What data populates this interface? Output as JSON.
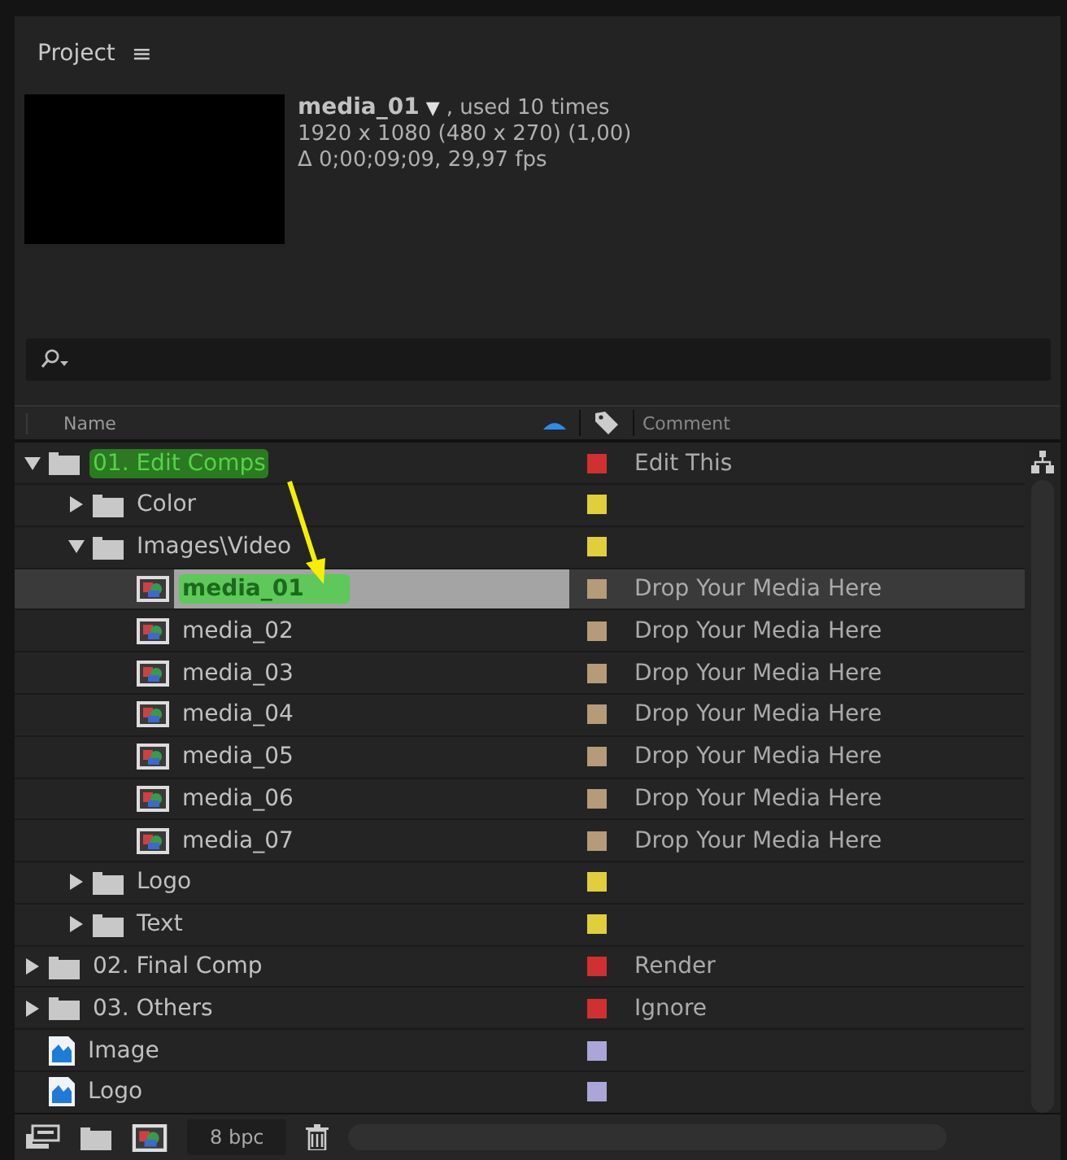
{
  "panel": {
    "title": "Project",
    "menu_glyph": "≡"
  },
  "preview": {
    "name": "media_01",
    "dropdown_glyph": "▼",
    "usage": ", used 10 times",
    "dimensions": "1920 x 1080  (480 x 270) (1,00)",
    "duration": "Δ 0;00;09;09, 29,97 fps"
  },
  "columns": [
    {
      "label": "Name",
      "sorted": true
    },
    {
      "label": "Comment",
      "sorted": false
    }
  ],
  "tree": [
    {
      "kind": "folder",
      "name": "01. Edit Comps",
      "expanded": true,
      "selected": false,
      "highlighted": true,
      "color": "#d03030",
      "comment": "Edit This",
      "children": [
        {
          "kind": "folder",
          "name": "Color",
          "expanded": false,
          "selected": false,
          "highlighted": false,
          "color": "#e0cf3a"
        },
        {
          "kind": "folder",
          "name": "Images\\Video",
          "expanded": true,
          "selected": false,
          "highlighted": false,
          "color": "#e0cf3a",
          "children": [
            {
              "kind": "comp",
              "name": "media_01",
              "selected": true,
              "highlighted": true,
              "color": "#b59b78",
              "comment": "Drop Your Media Here"
            },
            {
              "kind": "comp",
              "name": "media_02",
              "selected": false,
              "highlighted": false,
              "color": "#b59b78",
              "comment": "Drop Your Media Here"
            },
            {
              "kind": "comp",
              "name": "media_03",
              "selected": false,
              "highlighted": false,
              "color": "#b59b78",
              "comment": "Drop Your Media Here"
            },
            {
              "kind": "comp",
              "name": "media_04",
              "selected": false,
              "highlighted": false,
              "color": "#b59b78",
              "comment": "Drop Your Media Here"
            },
            {
              "kind": "comp",
              "name": "media_05",
              "selected": false,
              "highlighted": false,
              "color": "#b59b78",
              "comment": "Drop Your Media Here"
            },
            {
              "kind": "comp",
              "name": "media_06",
              "selected": false,
              "highlighted": false,
              "color": "#b59b78",
              "comment": "Drop Your Media Here"
            },
            {
              "kind": "comp",
              "name": "media_07",
              "selected": false,
              "highlighted": false,
              "color": "#b59b78",
              "comment": "Drop Your Media Here"
            }
          ]
        },
        {
          "kind": "folder",
          "name": "Logo",
          "expanded": false,
          "selected": false,
          "highlighted": false,
          "color": "#e0cf3a"
        },
        {
          "kind": "folder",
          "name": "Text",
          "expanded": false,
          "selected": false,
          "highlighted": false,
          "color": "#e0cf3a"
        }
      ]
    },
    {
      "kind": "folder",
      "name": "02. Final Comp",
      "expanded": false,
      "selected": false,
      "highlighted": false,
      "color": "#d03030",
      "comment": "Render"
    },
    {
      "kind": "folder",
      "name": "03. Others",
      "expanded": false,
      "selected": false,
      "highlighted": false,
      "color": "#d03030",
      "comment": "Ignore"
    },
    {
      "kind": "image",
      "name": "Image",
      "selected": false,
      "highlighted": false,
      "color": "#aaa6d8"
    },
    {
      "kind": "image",
      "name": "Logo",
      "selected": false,
      "highlighted": false,
      "color": "#aaa6d8"
    }
  ],
  "footer": {
    "bit_depth": "8 bpc"
  }
}
